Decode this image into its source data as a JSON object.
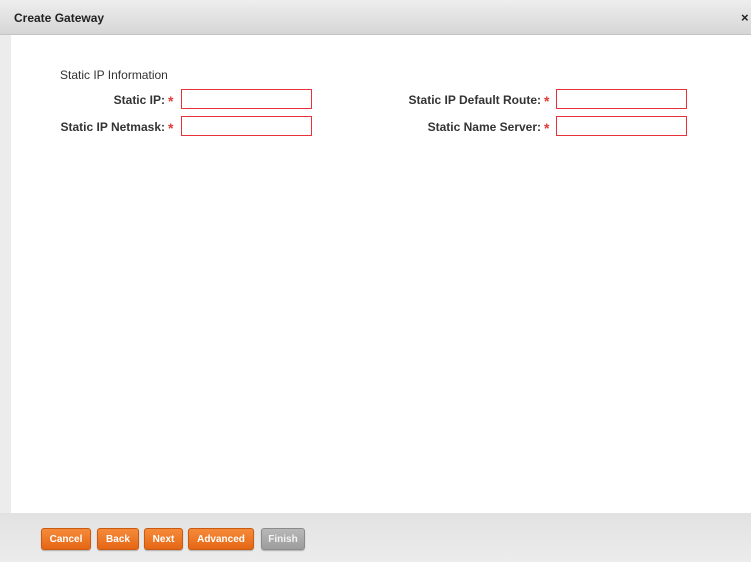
{
  "window": {
    "title": "Create Gateway",
    "close_glyph": "×"
  },
  "form": {
    "section_label": "Static IP Information",
    "required_marker": "*",
    "fields": {
      "static_ip": {
        "label": "Static IP:",
        "value": ""
      },
      "static_ip_netmask": {
        "label": "Static IP Netmask:",
        "value": ""
      },
      "static_ip_default_route": {
        "label": "Static IP Default Route:",
        "value": ""
      },
      "static_name_server": {
        "label": "Static Name Server:",
        "value": ""
      }
    }
  },
  "footer": {
    "buttons": {
      "cancel": "Cancel",
      "back": "Back",
      "next": "Next",
      "advanced": "Advanced",
      "finish": "Finish"
    }
  },
  "colors": {
    "accent_orange": "#e56614",
    "required_red": "#e03a3a",
    "field_border_red": "#e8313a",
    "disabled_gray": "#9d9d9d"
  }
}
